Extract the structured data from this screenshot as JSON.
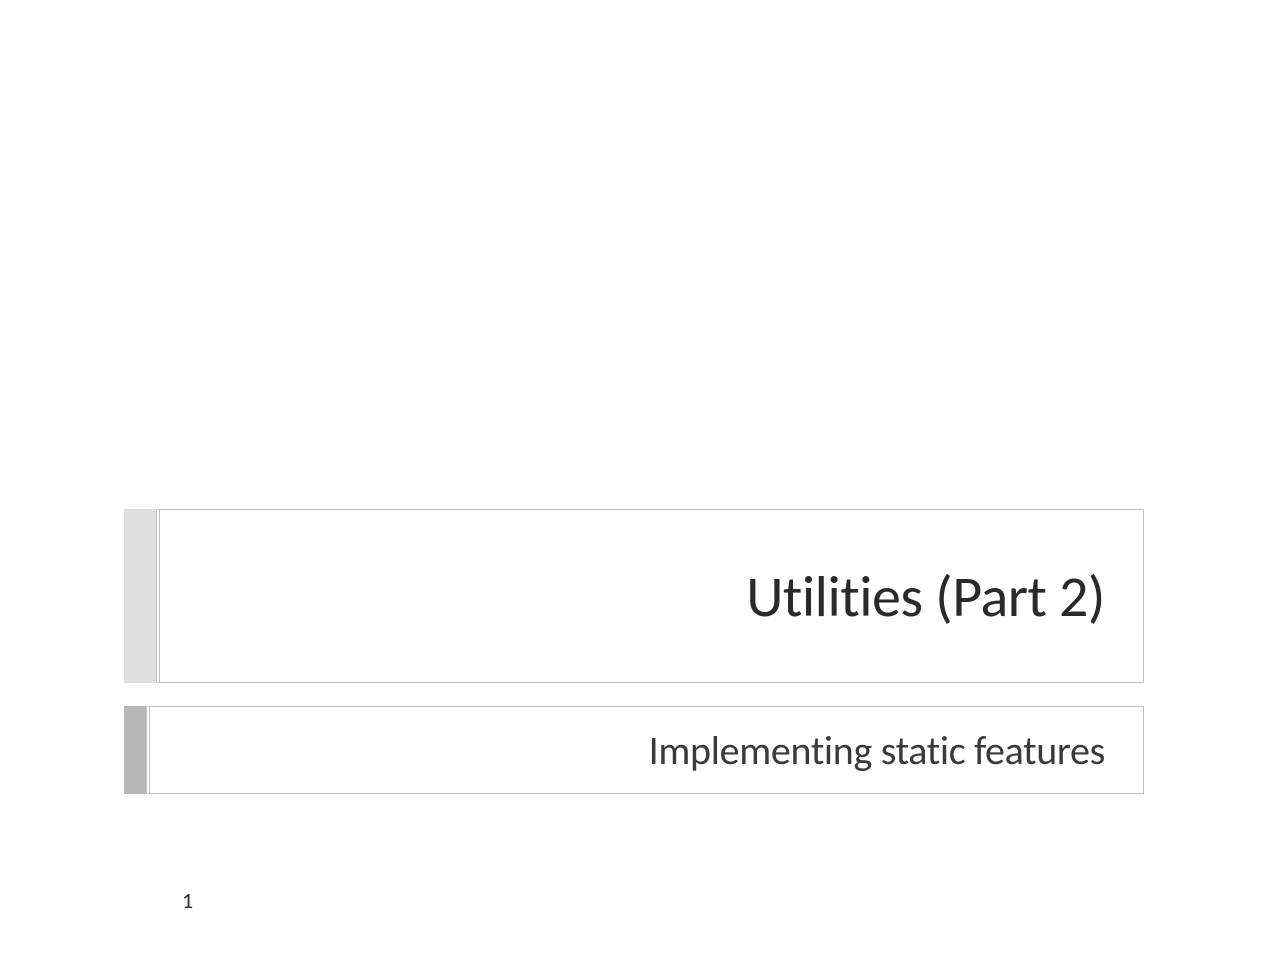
{
  "slide": {
    "title": "Utilities (Part 2)",
    "subtitle": "Implementing static features",
    "page_number": "1"
  },
  "colors": {
    "title_accent": "#e0e0e0",
    "subtitle_accent": "#b7b7b7",
    "border": "#bfbfbf",
    "text_primary": "#2a2a2a",
    "text_secondary": "#3a3a3a"
  }
}
